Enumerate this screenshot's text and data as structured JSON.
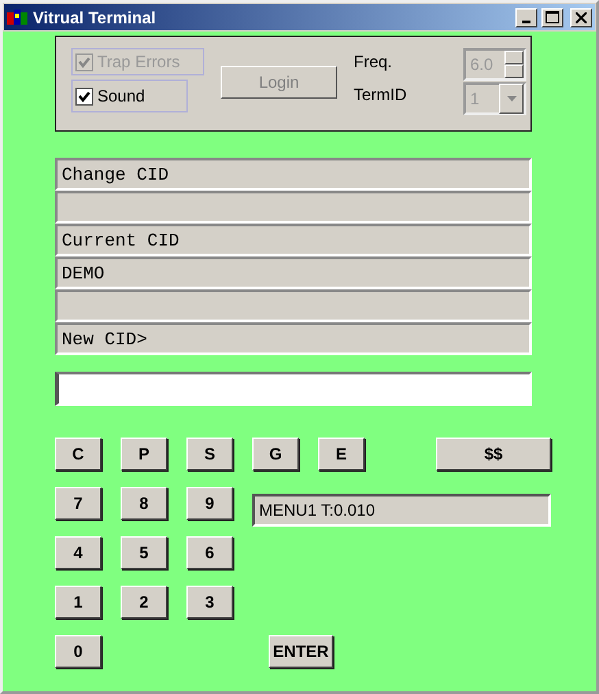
{
  "window": {
    "title": "Vitrual Terminal"
  },
  "settings": {
    "checkboxes": [
      {
        "label": "Trap Errors",
        "checked": true,
        "disabled": true
      },
      {
        "label": "Sound",
        "checked": true,
        "disabled": false
      }
    ],
    "login_button": {
      "label": "Login",
      "disabled": true
    },
    "freq": {
      "label": "Freq.",
      "value": "6.0",
      "disabled": true
    },
    "term_id": {
      "label": "TermID",
      "value": "1",
      "disabled": true
    }
  },
  "terminal_lines": [
    {
      "kind": "text",
      "text": "Change CID"
    },
    {
      "kind": "blank"
    },
    {
      "kind": "text",
      "text": "Current CID"
    },
    {
      "kind": "text",
      "text": "DEMO"
    },
    {
      "kind": "blank"
    },
    {
      "kind": "text",
      "text": "New CID>"
    }
  ],
  "input": {
    "focused": true
  },
  "keypad": {
    "rows": [
      [
        "C",
        "P",
        "S",
        "G",
        "E",
        "$$"
      ],
      [
        "7",
        "8",
        "9"
      ],
      [
        "4",
        "5",
        "6"
      ],
      [
        "1",
        "2",
        "3"
      ],
      [
        "0"
      ]
    ]
  },
  "status_field": {
    "value": "MENU1 T:0.010"
  },
  "enter_button": {
    "label": "ENTER"
  }
}
